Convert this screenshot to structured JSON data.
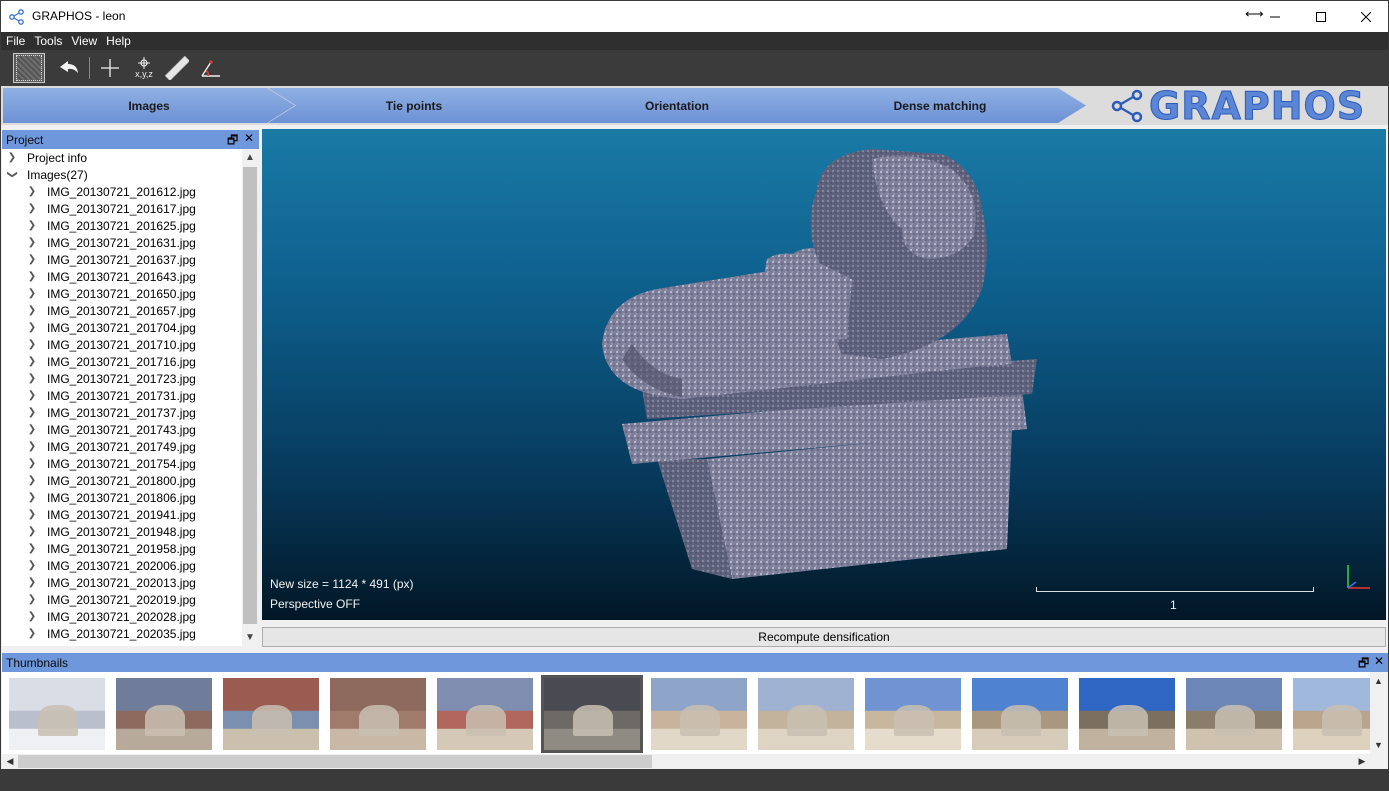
{
  "window": {
    "title": "GRAPHOS - leon",
    "controls": [
      "minimize-icon",
      "maximize-icon",
      "close-icon"
    ]
  },
  "menu": [
    "File",
    "Tools",
    "View",
    "Help"
  ],
  "toolbar": {
    "tools": [
      "selection-icon",
      "undo-icon",
      "crosshair-icon",
      "xyz-point-icon",
      "measure-ruler-icon",
      "angle-icon"
    ],
    "xyz_label": "x,y,z"
  },
  "workflow": {
    "steps": [
      "Images",
      "Tie points",
      "Orientation",
      "Dense matching"
    ],
    "logo_text": "GRAPHOS"
  },
  "project_panel": {
    "title": "Project",
    "project_info": "Project info",
    "images_label": "Images(27)",
    "images": [
      "IMG_20130721_201612.jpg",
      "IMG_20130721_201617.jpg",
      "IMG_20130721_201625.jpg",
      "IMG_20130721_201631.jpg",
      "IMG_20130721_201637.jpg",
      "IMG_20130721_201643.jpg",
      "IMG_20130721_201650.jpg",
      "IMG_20130721_201657.jpg",
      "IMG_20130721_201704.jpg",
      "IMG_20130721_201710.jpg",
      "IMG_20130721_201716.jpg",
      "IMG_20130721_201723.jpg",
      "IMG_20130721_201731.jpg",
      "IMG_20130721_201737.jpg",
      "IMG_20130721_201743.jpg",
      "IMG_20130721_201749.jpg",
      "IMG_20130721_201754.jpg",
      "IMG_20130721_201800.jpg",
      "IMG_20130721_201806.jpg",
      "IMG_20130721_201941.jpg",
      "IMG_20130721_201948.jpg",
      "IMG_20130721_201958.jpg",
      "IMG_20130721_202006.jpg",
      "IMG_20130721_202013.jpg",
      "IMG_20130721_202019.jpg",
      "IMG_20130721_202028.jpg",
      "IMG_20130721_202035.jpg"
    ]
  },
  "viewer": {
    "new_size": "New size = 1124 * 491 (px)",
    "perspective": "Perspective OFF",
    "scale_label": "1"
  },
  "recompute_button": "Recompute densification",
  "thumbnails_panel": {
    "title": "Thumbnails",
    "count_visible": 13,
    "selected_index": 5
  },
  "colors": {
    "panel_header": "#6f98dc",
    "workflow_step": "#7aa0dc",
    "viewer_top": "#1a7aa6",
    "viewer_bottom": "#021726"
  }
}
